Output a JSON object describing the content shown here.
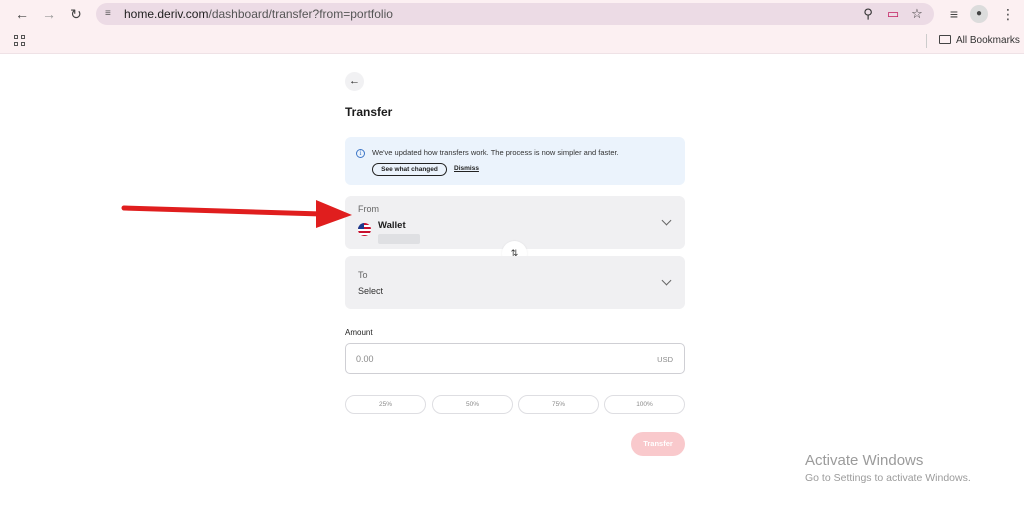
{
  "browser": {
    "url_domain": "home.deriv.com",
    "url_path": "/dashboard/transfer?from=portfolio",
    "bookmarks_label": "All Bookmarks"
  },
  "page": {
    "title": "Transfer",
    "notice": {
      "text": "We've updated how transfers work. The process is now simpler and faster.",
      "see_button": "See what changed",
      "dismiss_link": "Dismiss"
    },
    "from": {
      "label": "From",
      "account_name": "Wallet"
    },
    "to": {
      "label": "To",
      "value": "Select"
    },
    "amount": {
      "label": "Amount",
      "placeholder": "0.00",
      "currency": "USD"
    },
    "percent_options": [
      "25%",
      "50%",
      "75%",
      "100%"
    ],
    "submit_button": "Transfer"
  },
  "watermark": {
    "title": "Activate Windows",
    "subtitle": "Go to Settings to activate Windows."
  },
  "colors": {
    "annotation_arrow": "#e01e1e",
    "transfer_button_disabled": "#f9c9cc",
    "notice_background": "#ebf3fc"
  }
}
